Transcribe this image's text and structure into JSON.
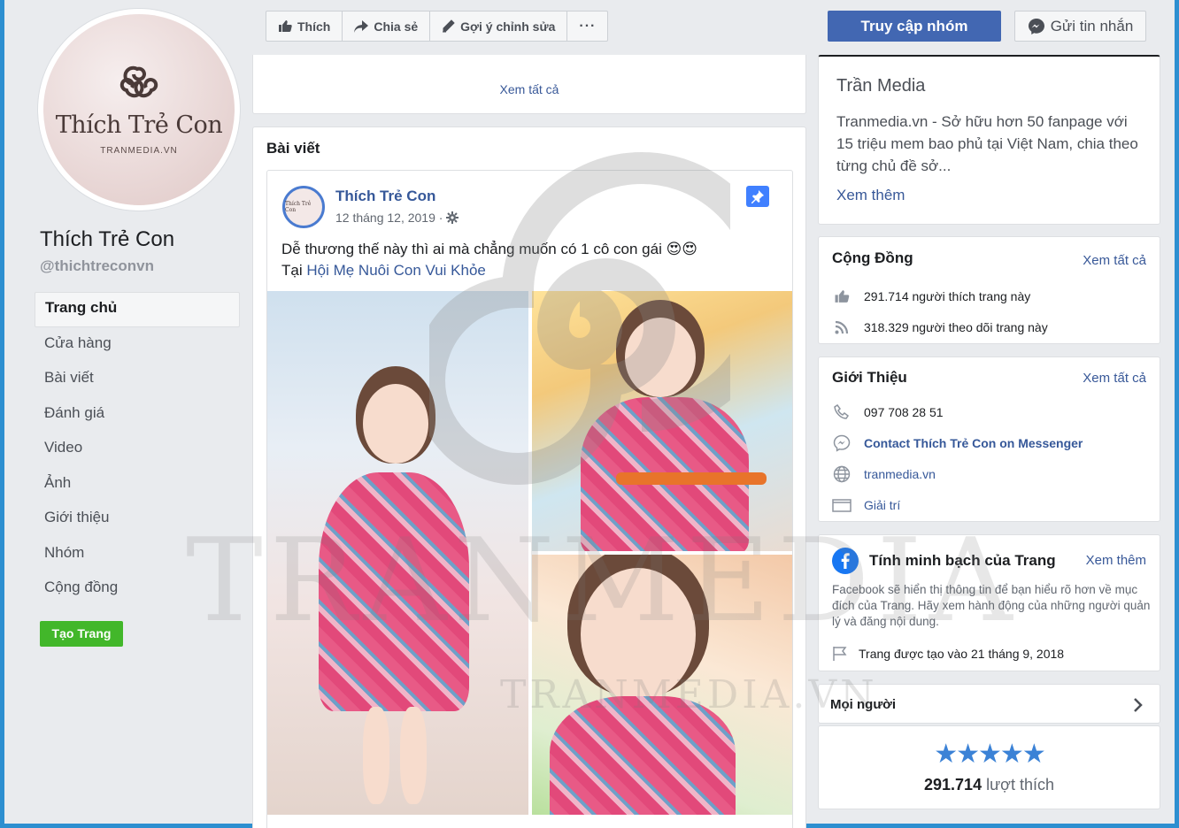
{
  "profile": {
    "avatar_name": "Thích Trẻ Con",
    "avatar_sub": "TRANMEDIA.VN",
    "page_name": "Thích Trẻ Con",
    "handle": "@thichtreconvn"
  },
  "nav": {
    "items": [
      "Trang chủ",
      "Cửa hàng",
      "Bài viết",
      "Đánh giá",
      "Video",
      "Ảnh",
      "Giới thiệu",
      "Nhóm",
      "Cộng đồng"
    ],
    "create_page": "Tạo Trang"
  },
  "actions": {
    "like": "Thích",
    "share": "Chia sẻ",
    "suggest_edit": "Gợi ý chỉnh sửa",
    "more": "···"
  },
  "top_card": {
    "see_all": "Xem tất cả"
  },
  "posts": {
    "title": "Bài viết",
    "post": {
      "avatar_text": "Thích Trẻ Con",
      "author": "Thích Trẻ Con",
      "date": "12 tháng 12, 2019 ·",
      "text": "Dễ thương thế này thì ai mà chẳng muốn có 1 cô con gái 😍😍",
      "location_prefix": "Tại ",
      "location": "Hội Mẹ Nuôi Con Vui Khỏe"
    }
  },
  "header_buttons": {
    "visit_group": "Truy cập nhóm",
    "send_message": "Gửi tin nhắn"
  },
  "ad": {
    "title": "Trần Media",
    "desc": "Tranmedia.vn - Sở hữu hơn 50 fanpage với 15 triệu mem bao phủ tại Việt Nam, chia theo từng chủ đề sở...",
    "more": "Xem thêm"
  },
  "community": {
    "title": "Cộng Đồng",
    "see_all": "Xem tất cả",
    "likes": "291.714 người thích trang này",
    "follows": "318.329 người theo dõi trang này"
  },
  "about": {
    "title": "Giới Thiệu",
    "see_all": "Xem tất cả",
    "phone": "097 708 28 51",
    "messenger": "Contact Thích Trẻ Con on Messenger",
    "website": "tranmedia.vn",
    "category": "Giải trí"
  },
  "transparency": {
    "title": "Tính minh bạch của Trang",
    "see_more": "Xem thêm",
    "desc": "Facebook sẽ hiển thị thông tin để bạn hiểu rõ hơn về mục đích của Trang. Hãy xem hành động của những người quản lý và đăng nội dung.",
    "created": "Trang được tạo vào 21 tháng 9, 2018"
  },
  "people": {
    "title": "Mọi người"
  },
  "rating": {
    "stars": "★★★★★",
    "count": "291.714",
    "suffix": " lượt thích"
  },
  "watermark": {
    "text": "TRANMEDIA",
    "sub": "TRANMEDIA.VN"
  },
  "colors": {
    "accent": "#4267b2",
    "link": "#385898",
    "green": "#42b72a",
    "frame": "#2d8fd0"
  }
}
